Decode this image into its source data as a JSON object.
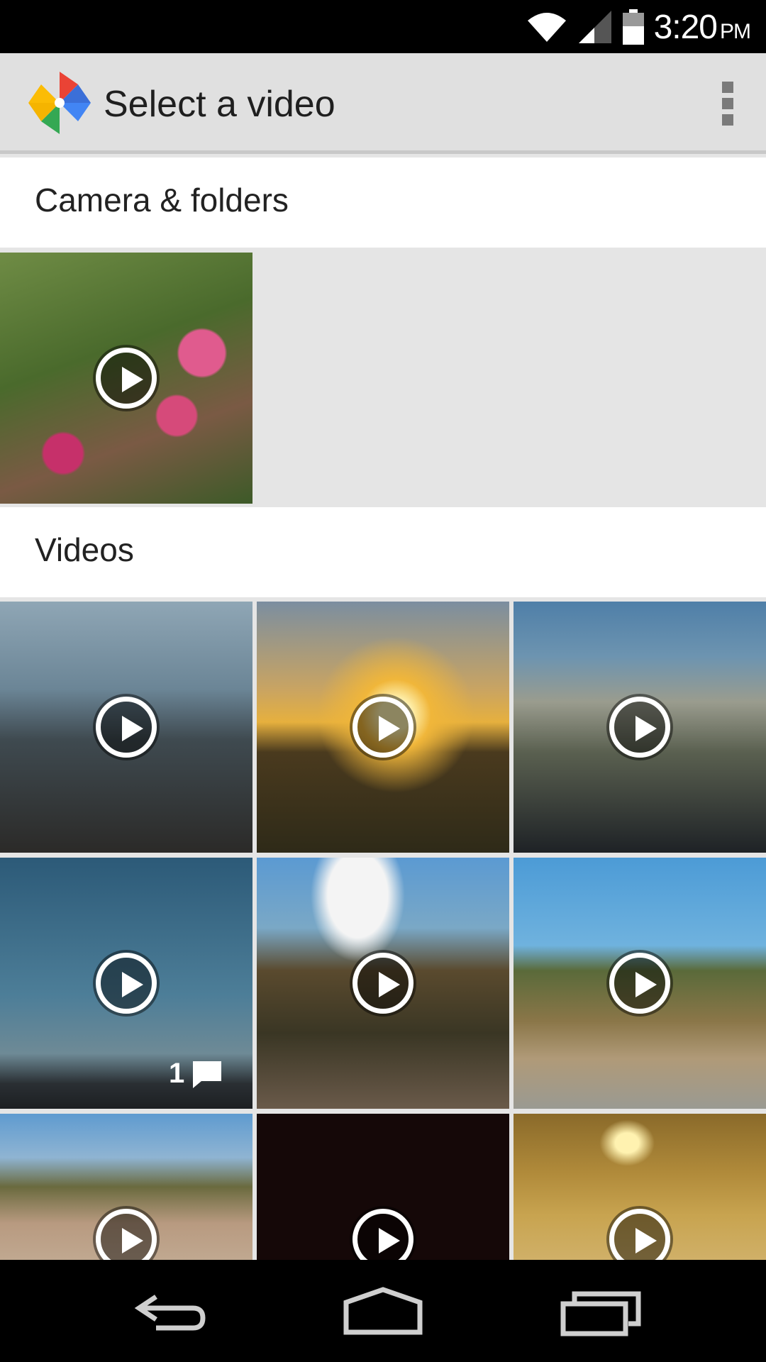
{
  "status_bar": {
    "time": "3:20",
    "ampm": "PM",
    "icons": [
      "wifi-icon",
      "signal-icon",
      "battery-icon"
    ]
  },
  "action_bar": {
    "title": "Select a video",
    "logo_icon": "photos-pinwheel-icon",
    "overflow_icon": "overflow-menu-icon"
  },
  "sections": [
    {
      "title": "Camera & folders"
    },
    {
      "title": "Videos"
    }
  ],
  "thumbnails": {
    "camera": [
      {
        "subject": "flowers"
      }
    ],
    "videos": [
      {
        "subject": "water-rocks"
      },
      {
        "subject": "sunset"
      },
      {
        "subject": "city-hill"
      },
      {
        "subject": "highway",
        "comment_count": "1"
      },
      {
        "subject": "trees-sky"
      },
      {
        "subject": "hill"
      },
      {
        "subject": "hill-2"
      },
      {
        "subject": "dark"
      },
      {
        "subject": "tunnel"
      }
    ]
  },
  "colors": {
    "status_bar": "#000000",
    "action_bar": "#e0e0e0",
    "grid_bg": "#e5e5e5"
  },
  "nav": {
    "back_icon": "back-icon",
    "home_icon": "home-icon",
    "recents_icon": "recents-icon"
  }
}
